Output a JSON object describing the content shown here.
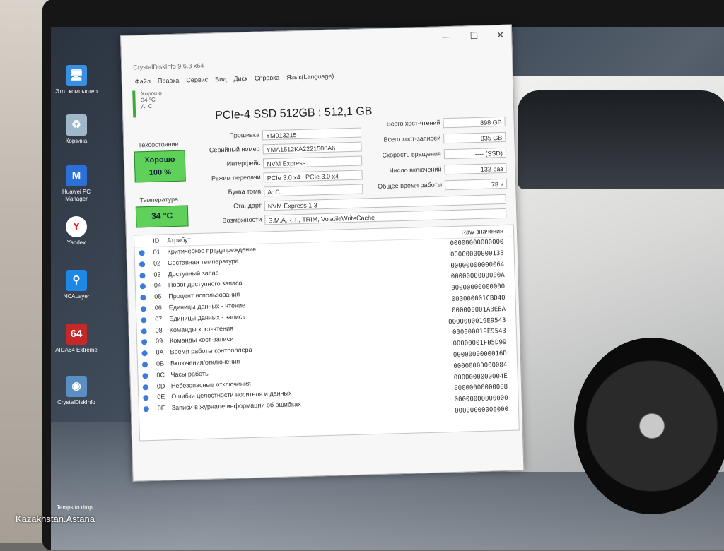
{
  "window": {
    "title": "CrystalDiskInfo 9.6.3 x64",
    "caption_buttons": [
      "—",
      "☐",
      "✕"
    ],
    "menu": [
      "Файл",
      "Правка",
      "Сервис",
      "Вид",
      "Диск",
      "Справка",
      "Язык(Language)"
    ],
    "drive_tab": {
      "status": "Хорошо",
      "temp": "34 °C",
      "letter": "A: C:"
    }
  },
  "drive": {
    "model": "PCIe-4 SSD 512GB : 512,1 GB",
    "health_label": "Техсостояние",
    "health_status": "Хорошо",
    "health_percent": "100 %",
    "temp_label": "Температура",
    "temp_value": "34 °C",
    "fields_left": [
      {
        "label": "Прошивка",
        "value": "YM013215"
      },
      {
        "label": "Серийный номер",
        "value": "YMA1512KA2221506A6"
      },
      {
        "label": "Интерфейс",
        "value": "NVM Express"
      },
      {
        "label": "Режим передачи",
        "value": "PCIe 3.0 x4 | PCIe 3.0 x4"
      },
      {
        "label": "Буква тома",
        "value": "A: C:"
      },
      {
        "label": "Стандарт",
        "value": "NVM Express 1.3"
      },
      {
        "label": "Возможности",
        "value": "S.M.A.R.T., TRIM, VolatileWriteCache"
      }
    ],
    "fields_right": [
      {
        "label": "Всего хост-чтений",
        "value": "898 GB"
      },
      {
        "label": "Всего хост-записей",
        "value": "835 GB"
      },
      {
        "label": "Скорость вращения",
        "value": "---- (SSD)"
      },
      {
        "label": "Число включений",
        "value": "132 раз"
      },
      {
        "label": "Общее время работы",
        "value": "78 ч"
      }
    ]
  },
  "attributes": {
    "headers": {
      "id": "ID",
      "name": "Атрибут",
      "raw": "Raw-значения"
    },
    "rows": [
      {
        "id": "01",
        "name": "Критическое предупреждение",
        "raw": "00000000000000"
      },
      {
        "id": "02",
        "name": "Составная температура",
        "raw": "00000000000133"
      },
      {
        "id": "03",
        "name": "Доступный запас",
        "raw": "00000000000064"
      },
      {
        "id": "04",
        "name": "Порог доступного запаса",
        "raw": "0000000000000A"
      },
      {
        "id": "05",
        "name": "Процент использования",
        "raw": "00000000000000"
      },
      {
        "id": "06",
        "name": "Единицы данных - чтение",
        "raw": "000000001CBD40"
      },
      {
        "id": "07",
        "name": "Единицы данных - запись",
        "raw": "000000001ABEBA"
      },
      {
        "id": "08",
        "name": "Команды хост-чтения",
        "raw": "0000000019E9543"
      },
      {
        "id": "09",
        "name": "Команды хост-записи",
        "raw": "000000019E9543"
      },
      {
        "id": "0A",
        "name": "Время работы контроллера",
        "raw": "00000001FB5D99"
      },
      {
        "id": "0B",
        "name": "Включения/отключения",
        "raw": "0000000000016D"
      },
      {
        "id": "0C",
        "name": "Часы работы",
        "raw": "00000000000084"
      },
      {
        "id": "0D",
        "name": "Небезопасные отключения",
        "raw": "0000000000004E"
      },
      {
        "id": "0E",
        "name": "Ошибки целостности носителя и данных",
        "raw": "00000000000008"
      },
      {
        "id": "0F",
        "name": "Записи в журнале информации об ошибках",
        "raw": "00000000000000"
      },
      {
        "id": "",
        "name": "",
        "raw": "00000000000000"
      }
    ]
  },
  "desktop_icons": [
    {
      "label": "Этот компьютер",
      "icon": "computer-icon",
      "glyph": "🖥"
    },
    {
      "label": "Корзина",
      "icon": "recycle-bin-icon",
      "glyph": "♻"
    },
    {
      "label": "Huawei PC Manager",
      "icon": "huawei-pc-manager-icon",
      "glyph": "M"
    },
    {
      "label": "Yandex",
      "icon": "yandex-icon",
      "glyph": "Y"
    },
    {
      "label": "NCALayer",
      "icon": "ncalayer-icon",
      "glyph": "⚲"
    },
    {
      "label": "AIDA64 Extreme",
      "icon": "aida64-icon",
      "glyph": "64"
    },
    {
      "label": "CrystalDiskInfo",
      "icon": "crystaldiskinfo-icon",
      "glyph": "◉"
    }
  ],
  "taskbar_note": "Temps to drop",
  "caption": "Kazakhstan.Astana",
  "colors": {
    "health_good": "#5fd15a",
    "attr_dot": "#3c7bdc"
  }
}
